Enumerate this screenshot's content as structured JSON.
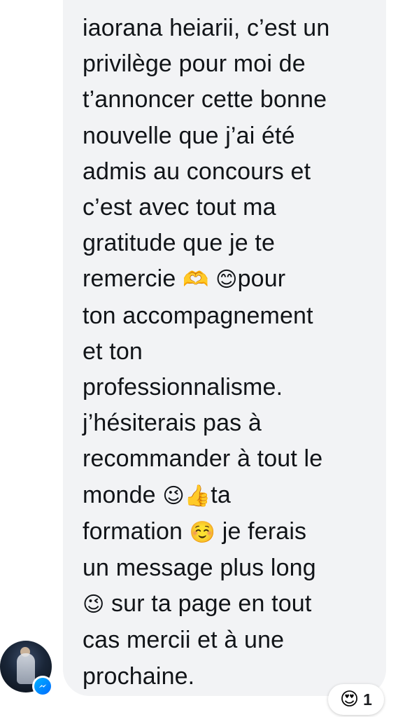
{
  "message": {
    "lines": [
      [
        {
          "t": "iaorana heiarii, c’est un"
        }
      ],
      [
        {
          "t": "privilège pour moi de"
        }
      ],
      [
        {
          "t": "t’annoncer cette bonne"
        }
      ],
      [
        {
          "t": "nouvelle que j’ai été"
        }
      ],
      [
        {
          "t": "admis au concours et"
        }
      ],
      [
        {
          "t": "c’est avec tout ma"
        }
      ],
      [
        {
          "t": "gratitude que je te"
        }
      ],
      [
        {
          "t": "remercie "
        },
        {
          "e": "🫶"
        },
        {
          "t": " "
        },
        {
          "e": "😊"
        },
        {
          "t": "pour"
        }
      ],
      [
        {
          "t": "ton accompagnement"
        }
      ],
      [
        {
          "t": "et ton"
        }
      ],
      [
        {
          "t": "professionnalisme."
        }
      ],
      [
        {
          "t": "j’hésiterais pas à"
        }
      ],
      [
        {
          "t": "recommander à tout le"
        }
      ],
      [
        {
          "t": "monde "
        },
        {
          "e": "😉"
        },
        {
          "e": "👍"
        },
        {
          "t": "ta"
        }
      ],
      [
        {
          "t": "formation "
        },
        {
          "e": "☺️"
        },
        {
          "t": " je ferais"
        }
      ],
      [
        {
          "t": "un message plus long"
        }
      ],
      [
        {
          "e": "😉"
        },
        {
          "t": "  sur ta page en tout"
        }
      ],
      [
        {
          "t": "cas mercii et à une"
        }
      ],
      [
        {
          "t": "prochaine."
        }
      ]
    ]
  },
  "reaction": {
    "emoji": "😍",
    "count": "1"
  },
  "icons": {
    "avatar": "user-avatar",
    "badge": "messenger-icon"
  },
  "colors": {
    "bubble": "#f2f3f5",
    "text": "#111418",
    "messenger_start": "#00b2ff",
    "messenger_end": "#006aff"
  }
}
